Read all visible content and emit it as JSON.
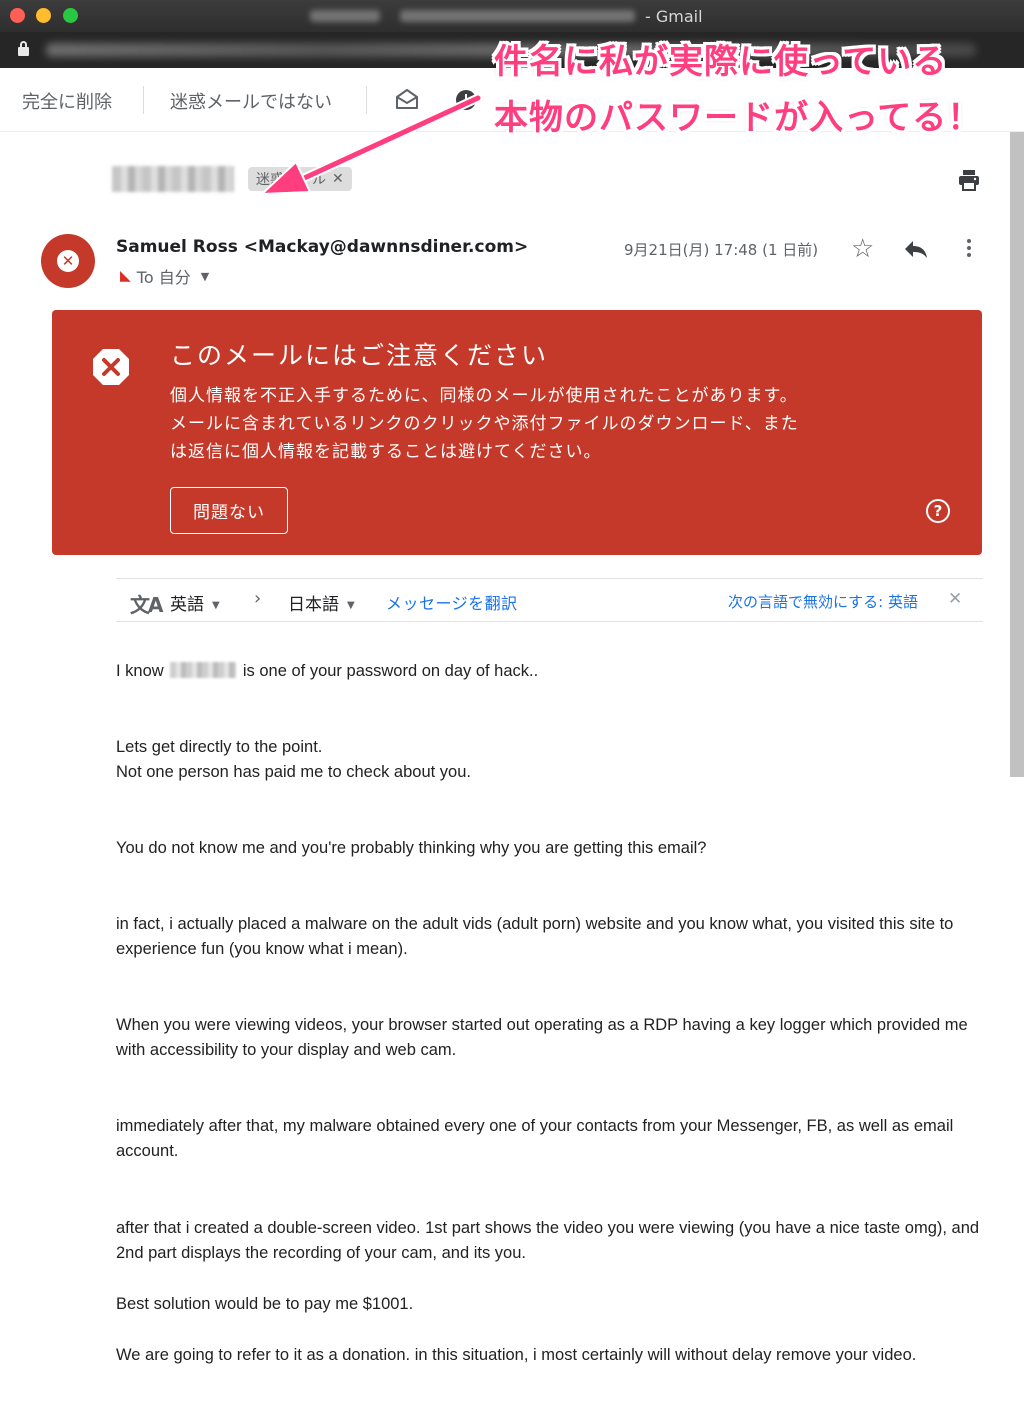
{
  "window": {
    "title_suffix": "- Gmail"
  },
  "toolbar": {
    "delete_forever": "完全に削除",
    "not_spam": "迷惑メールではない"
  },
  "annotation": {
    "line1": "件名に私が実際に使っている",
    "line2": "本物のパスワードが入ってる！",
    "color": "#ff3d7f"
  },
  "message": {
    "label": "迷惑メール",
    "sender": "Samuel Ross <Mackay@dawnnsdiner.com>",
    "to": "To 自分",
    "date": "9月21日(月) 17:48 (1 日前)"
  },
  "warning": {
    "title": "このメールにはご注意ください",
    "body": "個人情報を不正入手するために、同様のメールが使用されたことがあります。メールに含まれているリンクのクリックや添付ファイルのダウンロード、または返信に個人情報を記載することは避けてください。",
    "button": "問題ない",
    "color": "#c5392a"
  },
  "translate": {
    "source_lang": "英語",
    "target_lang": "日本語",
    "translate_link": "メッセージを翻訳",
    "disable_link": "次の言語で無効にする: 英語"
  },
  "body": {
    "p1_before": "I know",
    "p1_after": "is one of your password on day of hack..",
    "p2_l1": "Lets get directly to the point.",
    "p2_l2": "Not one person has paid me to check about you.",
    "p3": "You do not know me and you're probably thinking why you are getting this email?",
    "p4": "in fact, i actually placed a malware on the adult vids (adult porn) website and you know what, you visited this site to experience fun (you know what i mean).",
    "p5": "When you were viewing videos, your browser started out operating as a RDP having a key logger which provided me with accessibility to your display and web cam.",
    "p6": "immediately after that, my malware obtained every one of your contacts from your Messenger, FB, as well as email account.",
    "p7": "after that i created a double-screen video. 1st part shows the video you were viewing (you have a nice taste omg), and 2nd part displays the recording of your cam, and its you.",
    "p8": "Best solution would be to pay me $1001.",
    "p9": "We are going to refer to it as a donation. in this situation, i most certainly will without delay remove your video."
  }
}
